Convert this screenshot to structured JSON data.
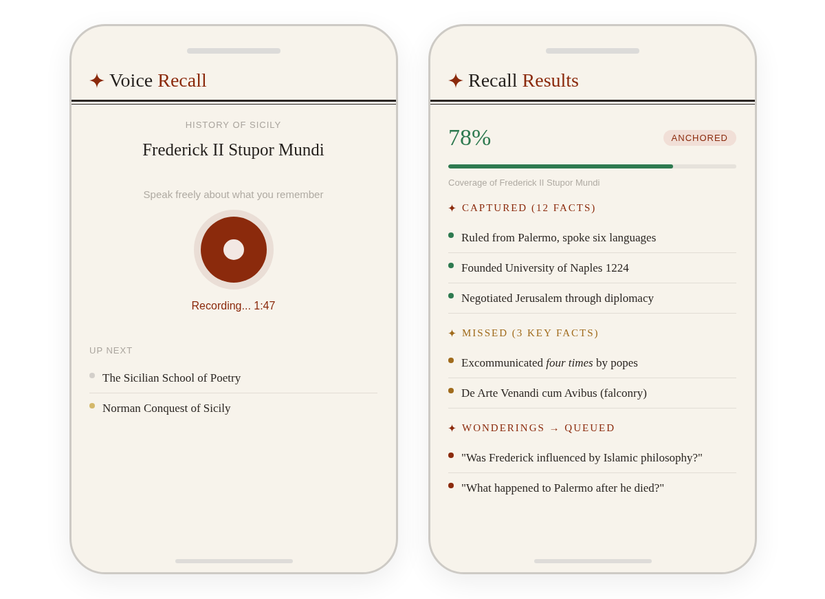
{
  "screens": [
    {
      "kind": "recording",
      "title": {
        "lead": "Voice",
        "accent": "Recall"
      },
      "subject": "HISTORY OF SICILY",
      "topic": "Frederick II Stupor Mundi",
      "prompt": "Speak freely about what you remember",
      "status": "Recording... 1:47",
      "up_next": {
        "label": "UP NEXT",
        "items": [
          {
            "text": "The Sicilian School of Poetry",
            "color": "#d3cfca"
          },
          {
            "text": "Norman Conquest of Sicily",
            "color": "#d4b86a"
          }
        ]
      }
    },
    {
      "kind": "results",
      "title": {
        "lead": "Recall",
        "accent": "Results"
      },
      "score": "78%",
      "badge": "ANCHORED",
      "coverage": {
        "level": 0.78,
        "caption": "Coverage of Frederick II Stupor Mundi"
      },
      "sections": [
        {
          "heading": "CAPTURED (12 FACTS)",
          "color": "#8b2a0c",
          "items": [
            {
              "text": "Ruled from Palermo, spoke six languages",
              "color": "#2e7a50"
            },
            {
              "text": "Founded University of Naples 1224",
              "color": "#2e7a50"
            },
            {
              "text": "Negotiated Jerusalem through diplomacy",
              "color": "#2e7a50"
            }
          ]
        },
        {
          "heading": "MISSED (3 KEY FACTS)",
          "color": "#a06b1c",
          "items": [
            {
              "text": "Excommunicated *four times* by popes",
              "color": "#a06b1c"
            },
            {
              "text": "De Arte Venandi cum Avibus (falconry)",
              "color": "#a06b1c"
            }
          ]
        },
        {
          "heading": "WONDERINGS → QUEUED",
          "color": "#8b2a0c",
          "items": [
            {
              "text": "\"Was Frederick influenced by Islamic philosophy?\"",
              "color": "#8b2a0c"
            },
            {
              "text": "\"What happened to Palermo after he died?\"",
              "color": "#8b2a0c"
            }
          ]
        }
      ]
    }
  ]
}
